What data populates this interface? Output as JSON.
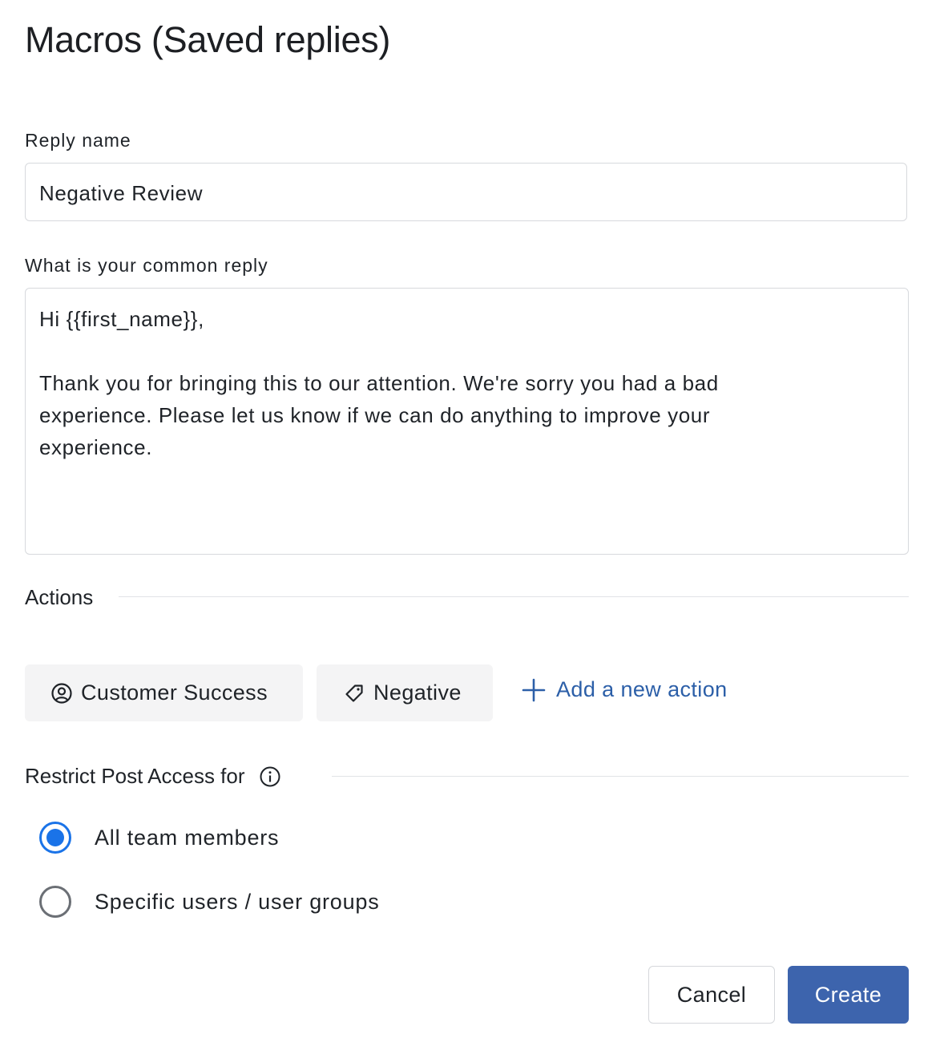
{
  "header": {
    "title": "Macros (Saved replies)"
  },
  "form": {
    "reply_name": {
      "label": "Reply name",
      "value": "Negative Review"
    },
    "common_reply": {
      "label": "What is your common reply",
      "lines": [
        "Hi {{first_name}},",
        "Thank you for bringing this to our attention. We're sorry you had a bad",
        "experience. Please let us know if we can do anything to improve your",
        "experience."
      ]
    }
  },
  "actions": {
    "title": "Actions",
    "chips": [
      {
        "label": "Customer Success",
        "icon": "user-circle-icon"
      },
      {
        "label": "Negative",
        "icon": "tag-icon"
      }
    ],
    "add_label": "Add a new action",
    "add_icon": "plus-icon"
  },
  "restrict": {
    "title": "Restrict Post Access for",
    "info_icon": "info-icon",
    "options": [
      {
        "label": "All team members",
        "selected": true
      },
      {
        "label": "Specific users / user groups",
        "selected": false
      }
    ]
  },
  "footer": {
    "cancel_label": "Cancel",
    "create_label": "Create"
  },
  "colors": {
    "primary": "#3d64ad",
    "link": "#2c5fa8",
    "radio_selected": "#1a73e8",
    "chip_bg": "#f4f4f5",
    "border": "#d7d9dd"
  }
}
